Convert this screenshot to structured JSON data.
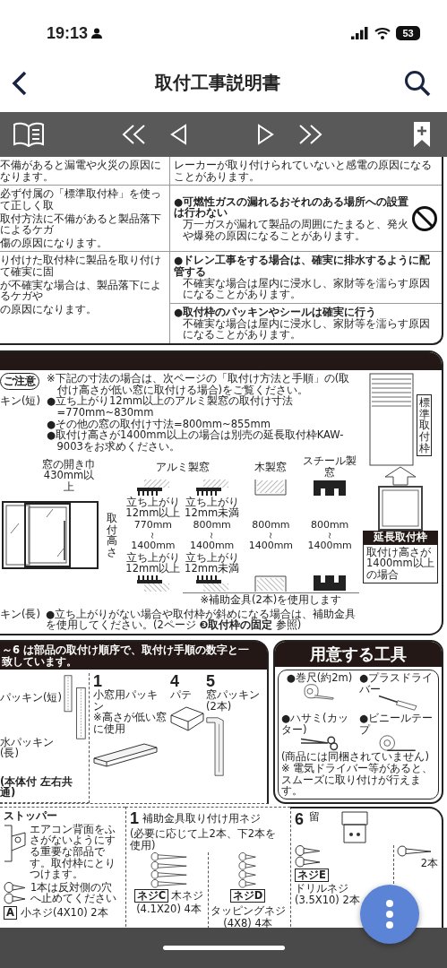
{
  "status_bar": {
    "time": "19:13",
    "battery": "53"
  },
  "nav": {
    "title": "取付工事説明書"
  },
  "warnings": {
    "rows": [
      {
        "left": [
          "不備があると漏電や火災の原因になります。"
        ],
        "right": [
          {
            "kind": "note",
            "text": "レーカーが取り付けられていないと感電の原因になることがあります。"
          }
        ]
      },
      {
        "left": [
          "必ず付属の「標準取付枠」を使って正しく取",
          "取付方法に不備があると製品落下によるケガ",
          "傷の原因になります。"
        ],
        "right": [
          {
            "kind": "prohibition",
            "heading": "●可燃性ガスの漏れるおそれのある場所への設置は行わない",
            "text": "万一ガスが漏れて製品の周囲にたまると、発火や爆発の原因になることがあります。"
          }
        ]
      },
      {
        "left": [
          "り付けた取付枠に製品を取り付けて確実に固",
          "が不確実な場合は、製品落下によるケガや",
          "の原因になります。"
        ],
        "right": [
          {
            "kind": "note",
            "heading": "●ドレン工事をする場合は、確実に排水するように配管する",
            "text": "不確実な場合は屋内に浸水し、家財等を濡らす原因になることがあります。"
          },
          {
            "kind": "note",
            "heading": "●取付枠のパッキンやシールは確実に行う",
            "text": "不確実な場合は屋内に浸水し、家財等を濡らす原因になることがあります。"
          }
        ]
      }
    ]
  },
  "dimensions": {
    "notice_label": "ご注意",
    "notes": [
      "※下記の寸法の場合は、次ページの「取付け方法と手順」の(取付け高さが低い窓に取付ける場合)をご覧ください。",
      "●立ち上がり12mm以上のアルミ製窓の取付け寸法=770mm~830mm",
      "●その他の窓の取付け寸法=800mm~855mm",
      "●取付け高さが1400mm以上の場合は別売の延長取付枠KAW-9003をお求めください。"
    ],
    "left_labels": [
      "キン(短)",
      "キン(長)"
    ],
    "window_width": "窓の開き巾430mm以上",
    "height_label": "取付高さ",
    "frame_types": [
      "アルミ製窓",
      "木製窓",
      "スチール製窓"
    ],
    "ranges": [
      {
        "kind": "aluminum",
        "upper": "立ち上がり12mm以上",
        "min": "770mm",
        "separator": "～",
        "max": "1400mm",
        "lower": "立ち上がり12mm以上"
      },
      {
        "kind": "aluminum",
        "upper": "立ち上がり12mm未満",
        "min": "800mm",
        "separator": "～",
        "max": "1400mm",
        "lower": "立ち上がり12mm未満"
      },
      {
        "kind": "wood",
        "min": "800mm",
        "separator": "～",
        "max": "1400mm"
      },
      {
        "kind": "steel",
        "min": "800mm",
        "separator": "～",
        "max": "1400mm"
      }
    ],
    "aux_note": "※補助金具(2本)を使用します",
    "bottom_note": "●立ち上がりがない場合や取付枠が斜めになる場合は、補助金具を使用してください。(2ページ **❸取付枠の固定** 参照)",
    "side": {
      "standard": "標準取付枠",
      "extended": "延長取付枠",
      "extended_note": "取付け高さが1400mm以上の場合"
    }
  },
  "parts": {
    "header": "**～6** は部品の取付け順序で、取付け手順の数字と一致しています。",
    "gaskets": [
      "パッキン(短)",
      "水パッキン(長)"
    ],
    "gasket_note": "(本体付 左右共通)",
    "items": [
      {
        "number": "1",
        "name": "小窓用パッキン",
        "note": "※高さが低い窓に使用",
        "kind": "bar"
      },
      {
        "number": "4",
        "name": "パテ",
        "kind": "block"
      },
      {
        "number": "5",
        "name": "窓パッキン(2本)",
        "kind": "strip"
      }
    ]
  },
  "tools": {
    "title": "用意する工具",
    "items": [
      {
        "name": "●巻尺(約2m)",
        "kind": "tape-measure"
      },
      {
        "name": "●プラスドライバー",
        "kind": "screwdriver"
      },
      {
        "name": "●ハサミ(カッター)",
        "kind": "scissors"
      },
      {
        "name": "●ビニールテープ",
        "kind": "tape"
      }
    ],
    "note": "(商品には同梱されていません)",
    "footnote": "※ 電気ドライバー等があると、スムーズに取り付けが行えます。"
  },
  "screws": {
    "stopper": {
      "title": "ストッパー",
      "desc": "エアコン背面をふさがないようにする重要な部品です。取付枠にとりつけます。",
      "hint": "1本は反対側の穴へ止めてください",
      "tag": "A",
      "name": "小ネジ(4X10) 2本"
    },
    "bracket": {
      "number": "1",
      "title": "補助金具取り付け用ネジ",
      "sub": "(必要に応じて上2本、下2本を使用)",
      "screws": [
        {
          "kind": "long",
          "tag": "ネジC",
          "name": "木ネジ",
          "spec": "(4.1X20) 4本"
        },
        {
          "kind": "pan",
          "tag": "ネジD",
          "name": "タッピングネジ",
          "spec": "(4X8) 4本"
        }
      ]
    },
    "lock": {
      "number": "6",
      "title": "留",
      "screws": [
        {
          "kind": "short",
          "tag": "ネジE",
          "name": "ドリルネジ",
          "spec": "(3.5X10) 2本"
        },
        {
          "kind": "hidden",
          "spec": "2本"
        }
      ]
    }
  }
}
